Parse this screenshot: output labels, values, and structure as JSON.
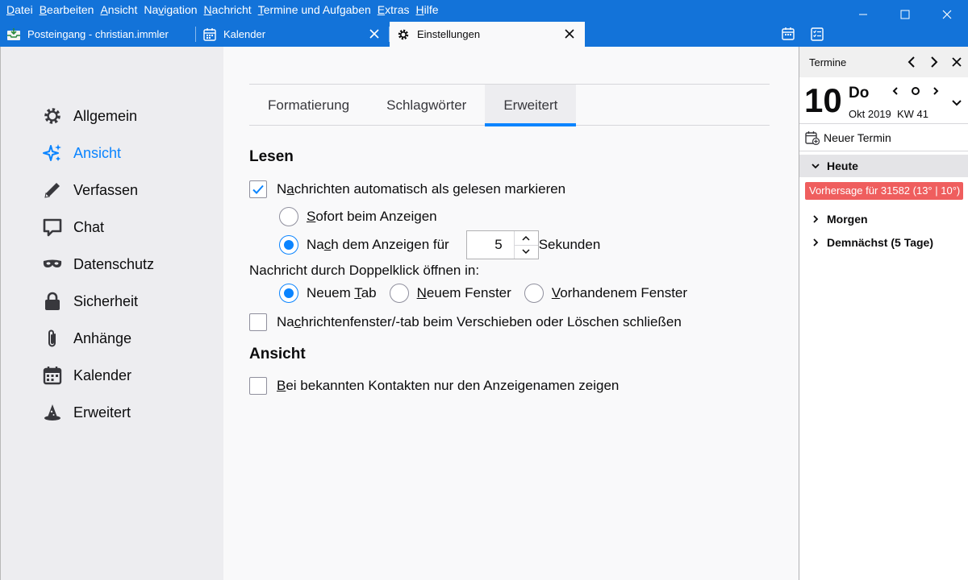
{
  "menubar": {
    "items": [
      {
        "pre": "",
        "u": "D",
        "post": "atei"
      },
      {
        "pre": "",
        "u": "B",
        "post": "earbeiten"
      },
      {
        "pre": "",
        "u": "A",
        "post": "nsicht"
      },
      {
        "pre": "Na",
        "u": "v",
        "post": "igation"
      },
      {
        "pre": "",
        "u": "N",
        "post": "achricht"
      },
      {
        "pre": "",
        "u": "T",
        "post": "ermine und Aufgaben"
      },
      {
        "pre": "",
        "u": "E",
        "post": "xtras"
      },
      {
        "pre": "",
        "u": "H",
        "post": "ilfe"
      }
    ]
  },
  "tabs": [
    {
      "label": "Posteingang - christian.immler",
      "icon": "inbox-icon"
    },
    {
      "label": "Kalender",
      "icon": "calendar-icon"
    },
    {
      "label": "Einstellungen",
      "icon": "gear-icon"
    }
  ],
  "categories": [
    {
      "label": "Allgemein",
      "icon": "gear-icon"
    },
    {
      "label": "Ansicht",
      "icon": "sparkle-icon"
    },
    {
      "label": "Verfassen",
      "icon": "pen-icon"
    },
    {
      "label": "Chat",
      "icon": "chat-icon"
    },
    {
      "label": "Datenschutz",
      "icon": "mask-icon"
    },
    {
      "label": "Sicherheit",
      "icon": "lock-icon"
    },
    {
      "label": "Anhänge",
      "icon": "paperclip-icon"
    },
    {
      "label": "Kalender",
      "icon": "calendar-icon"
    },
    {
      "label": "Erweitert",
      "icon": "wizard-hat-icon"
    }
  ],
  "subtabs": [
    "Formatierung",
    "Schlagwörter",
    "Erweitert"
  ],
  "settings": {
    "lesen_heading": "Lesen",
    "auto_mark": {
      "pre": "N",
      "u": "a",
      "post": "chrichten automatisch als gelesen markieren"
    },
    "immediately": {
      "pre": "",
      "u": "S",
      "post": "ofort beim Anzeigen"
    },
    "after": {
      "pre": "Na",
      "u": "c",
      "post": "h dem Anzeigen für"
    },
    "seconds_value": "5",
    "seconds_label": "Sekunden",
    "doubleclick_label": "Nachricht durch Doppelklick öffnen in:",
    "new_tab": {
      "pre": "Neuem ",
      "u": "T",
      "post": "ab"
    },
    "new_window": {
      "pre": "",
      "u": "N",
      "post": "euem Fenster"
    },
    "existing_window": {
      "pre": "",
      "u": "V",
      "post": "orhandenem Fenster"
    },
    "close_window": {
      "pre": "Na",
      "u": "c",
      "post": "hrichtenfenster/-tab beim Verschieben oder Löschen schließen"
    },
    "ansicht_heading": "Ansicht",
    "display_names": {
      "pre": "",
      "u": "B",
      "post": "ei bekannten Kontakten nur den Anzeigenamen zeigen"
    }
  },
  "today_pane": {
    "title": "Termine",
    "day_number": "10",
    "day_name": "Do",
    "month_year": "Okt 2019",
    "week": "KW 41",
    "new_event": "Neuer Termin",
    "today_label": "Heute",
    "event": "Vorhersage für 31582 (13° | 10°)",
    "tomorrow_label": "Morgen",
    "upcoming_label": "Demnächst (5 Tage)"
  },
  "colors": {
    "accent": "#0a84ff",
    "titlebar": "#1373d9",
    "event": "#ef5e5e"
  }
}
